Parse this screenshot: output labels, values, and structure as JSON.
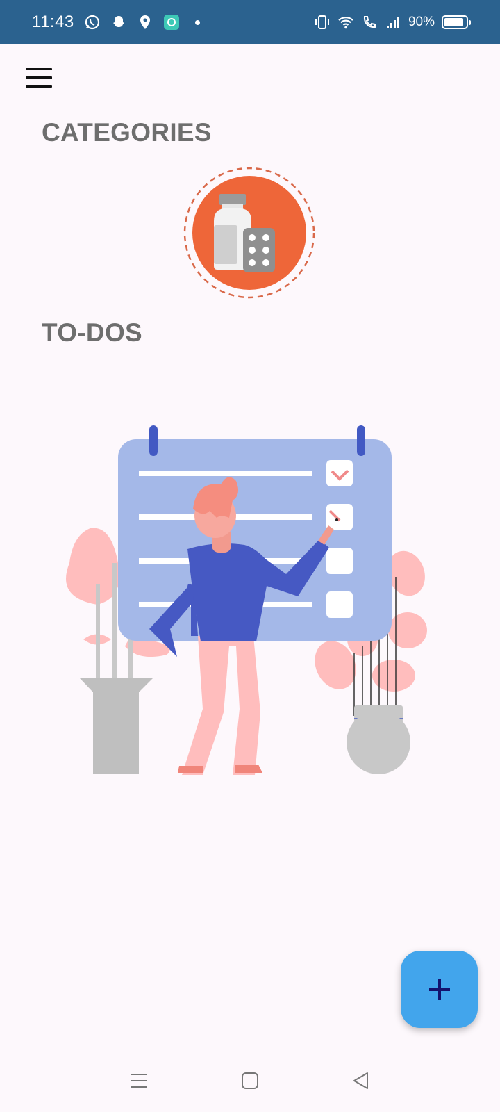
{
  "status_bar": {
    "time": "11:43",
    "battery_text": "90%",
    "battery_level": 0.9,
    "notification_icons": [
      "whatsapp-icon",
      "snapchat-icon",
      "location-pin-icon",
      "app-notification-icon"
    ],
    "system_icons": [
      "vibrate-icon",
      "wifi-icon",
      "wifi-call-icon",
      "signal-icon",
      "battery-icon"
    ]
  },
  "header": {
    "menu_icon": "hamburger-menu-icon"
  },
  "sections": {
    "categories_title": "CATEGORIES",
    "todos_title": "TO-DOS"
  },
  "categories": [
    {
      "icon": "medicine-icon",
      "color": "#ee6639"
    }
  ],
  "empty_state": {
    "illustration": "todo-checklist-illustration"
  },
  "fab": {
    "icon": "plus-icon",
    "color": "#42a5ec"
  },
  "nav_bar": {
    "icons": [
      "recents-icon",
      "home-icon",
      "back-icon"
    ]
  },
  "colors": {
    "status_bar": "#2b628f",
    "background": "#fdf8fc",
    "section_title": "#6e6e6e"
  }
}
